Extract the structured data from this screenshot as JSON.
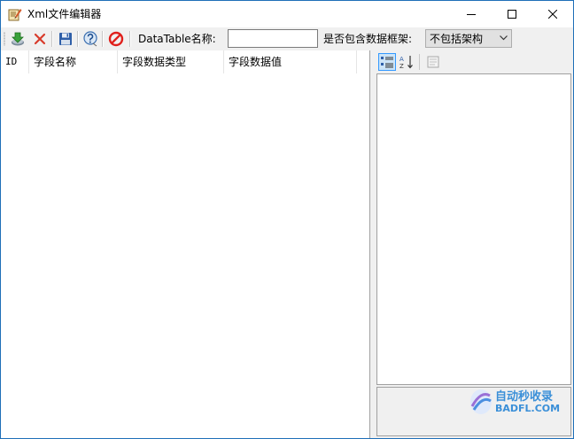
{
  "window": {
    "title": "Xml文件编辑器"
  },
  "toolbar": {
    "buttons": [
      {
        "name": "import-button",
        "icon": "download-icon"
      },
      {
        "name": "delete-button",
        "icon": "close-x-icon"
      },
      {
        "name": "save-button",
        "icon": "floppy-disk-icon"
      },
      {
        "name": "help-button",
        "icon": "help-icon"
      },
      {
        "name": "stop-button",
        "icon": "no-entry-icon"
      }
    ],
    "datatable_label": "DataTable名称:",
    "datatable_value": "",
    "schema_label": "是否包含数据框架:",
    "schema_selected": "不包括架构"
  },
  "grid": {
    "columns": [
      "ID",
      "字段名称",
      "字段数据类型",
      "字段数据值"
    ],
    "rows": []
  },
  "property_grid": {
    "buttons": [
      "categorized-view-icon",
      "alphabetical-sort-icon",
      "property-pages-icon"
    ]
  },
  "watermark": {
    "line1": "自动秒收录",
    "line2": "BADFL.COM"
  },
  "colors": {
    "accent": "#1f6fb8",
    "delete_red": "#d83b2b",
    "stop_red": "#e0201c",
    "watermark_blue": "#3a8fd8"
  }
}
